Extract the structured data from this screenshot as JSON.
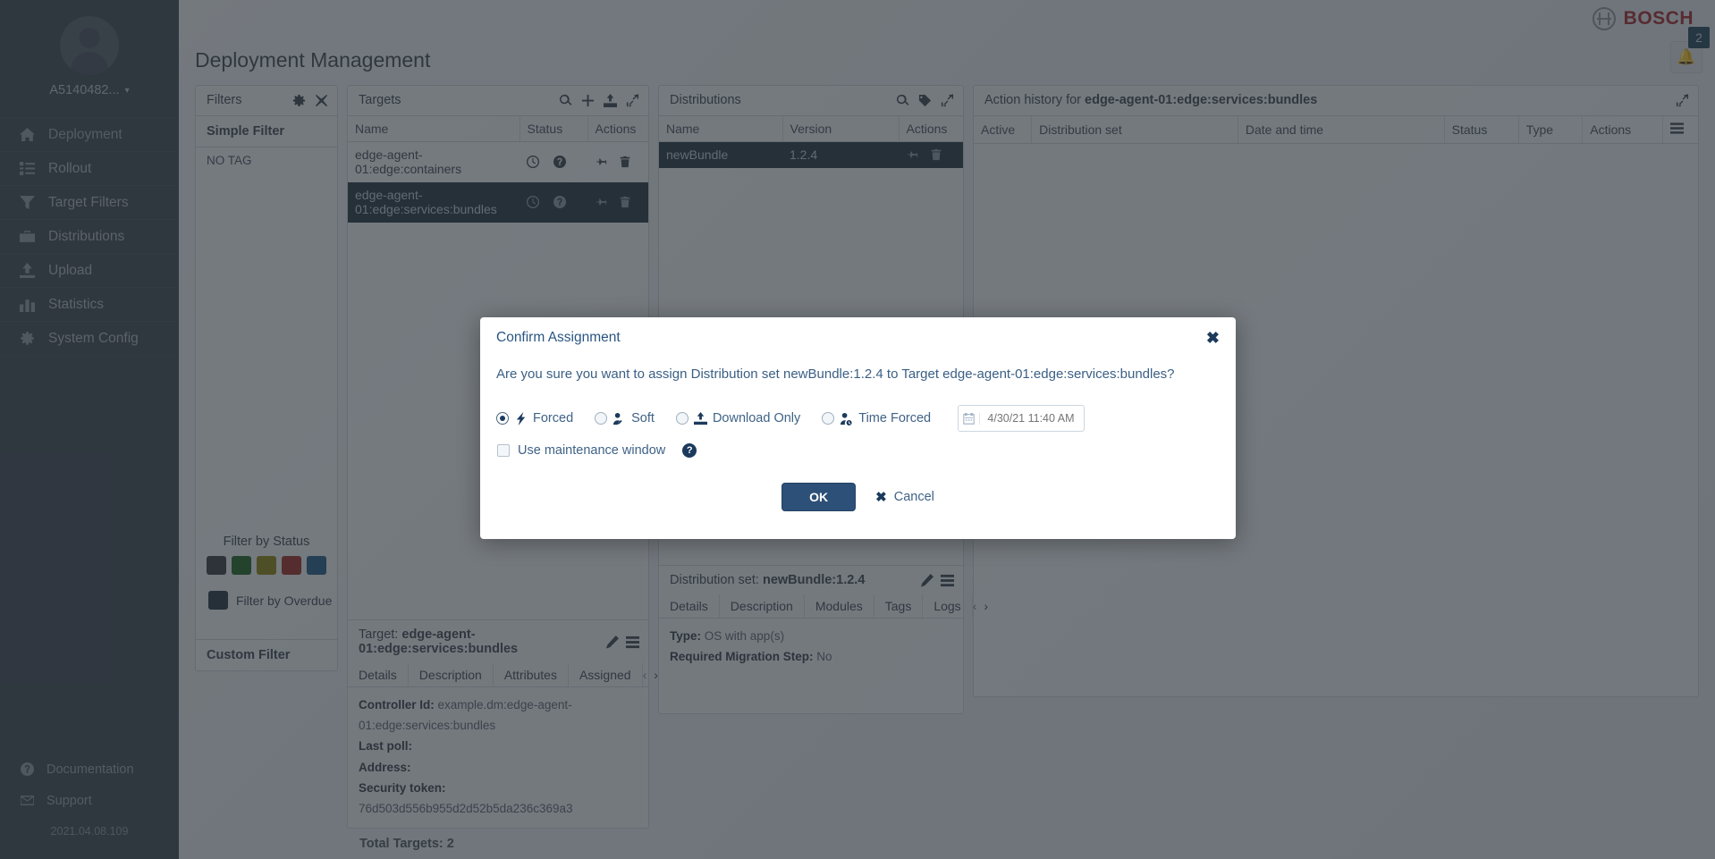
{
  "sidebar": {
    "user": "A5140482...",
    "caret": "chevron-down",
    "items": [
      {
        "label": "Deployment",
        "icon": "home-icon",
        "active": true
      },
      {
        "label": "Rollout",
        "icon": "list-icon",
        "active": false
      },
      {
        "label": "Target Filters",
        "icon": "funnel-icon",
        "active": false
      },
      {
        "label": "Distributions",
        "icon": "briefcase-icon",
        "active": false
      },
      {
        "label": "Upload",
        "icon": "upload-icon",
        "active": false
      },
      {
        "label": "Statistics",
        "icon": "bar-chart-icon",
        "active": false
      },
      {
        "label": "System Config",
        "icon": "gear-icon",
        "active": false
      }
    ],
    "bottom": [
      {
        "label": "Documentation",
        "icon": "help-circle-icon"
      },
      {
        "label": "Support",
        "icon": "envelope-icon"
      }
    ],
    "version": "2021.04.08.109"
  },
  "header": {
    "brand": "BOSCH",
    "page_title": "Deployment Management",
    "notification_count": "2"
  },
  "filters": {
    "title": "Filters",
    "section_title": "Simple Filter",
    "no_tag": "NO TAG",
    "status_title": "Filter by Status",
    "status_colors": [
      "#383c40",
      "#1d6420",
      "#8e8311",
      "#9e2a26",
      "#215a86"
    ],
    "overdue_label": "Filter by Overdue",
    "overdue_color": "#22323f",
    "custom_filter": "Custom Filter"
  },
  "targets": {
    "title": "Targets",
    "columns": [
      "Name",
      "Status",
      "Actions"
    ],
    "rows": [
      {
        "name": "edge-agent-01:edge:containers",
        "selected": false
      },
      {
        "name": "edge-agent-01:edge:services:bundles",
        "selected": true
      }
    ],
    "total": "Total Targets: 2"
  },
  "distributions": {
    "title": "Distributions",
    "columns": [
      "Name",
      "Version",
      "Actions"
    ],
    "rows": [
      {
        "name": "newBundle",
        "version": "1.2.4",
        "selected": true
      }
    ]
  },
  "action_history": {
    "title_prefix": "Action history for",
    "title_target": "edge-agent-01:edge:services:bundles",
    "columns": [
      "Active",
      "Distribution set",
      "Date and time",
      "Status",
      "Type",
      "Actions"
    ]
  },
  "target_detail": {
    "label": "Target:",
    "name": "edge-agent-01:edge:services:bundles",
    "tabs": [
      "Details",
      "Description",
      "Attributes",
      "Assigned"
    ],
    "fields": [
      {
        "key": "Controller Id:",
        "value": "example.dm:edge-agent-01:edge:services:bundles"
      },
      {
        "key": "Last poll:",
        "value": ""
      },
      {
        "key": "Address:",
        "value": ""
      },
      {
        "key": "Security token:",
        "value": "76d503d556b955d2d52b5da236c369a3"
      }
    ]
  },
  "distribution_detail": {
    "label": "Distribution set:",
    "name": "newBundle:1.2.4",
    "tabs": [
      "Details",
      "Description",
      "Modules",
      "Tags",
      "Logs"
    ],
    "fields": [
      {
        "key": "Type:",
        "value": "OS with app(s)"
      },
      {
        "key": "Required Migration Step:",
        "value": "No"
      }
    ]
  },
  "modal": {
    "title": "Confirm Assignment",
    "close": "✖",
    "message": "Are you sure you want to assign Distribution set newBundle:1.2.4 to Target edge-agent-01:edge:services:bundles?",
    "options": [
      {
        "label": "Forced",
        "icon": "bolt-icon",
        "selected": true
      },
      {
        "label": "Soft",
        "icon": "user-soft-icon",
        "selected": false
      },
      {
        "label": "Download Only",
        "icon": "download-icon",
        "selected": false
      },
      {
        "label": "Time Forced",
        "icon": "user-clock-icon",
        "selected": false
      }
    ],
    "date_placeholder": "4/30/21 11:40 AM",
    "date_value": "",
    "maintenance_label": "Use maintenance window",
    "maintenance_checked": false,
    "help": "?",
    "ok_label": "OK",
    "cancel_label": "Cancel"
  }
}
